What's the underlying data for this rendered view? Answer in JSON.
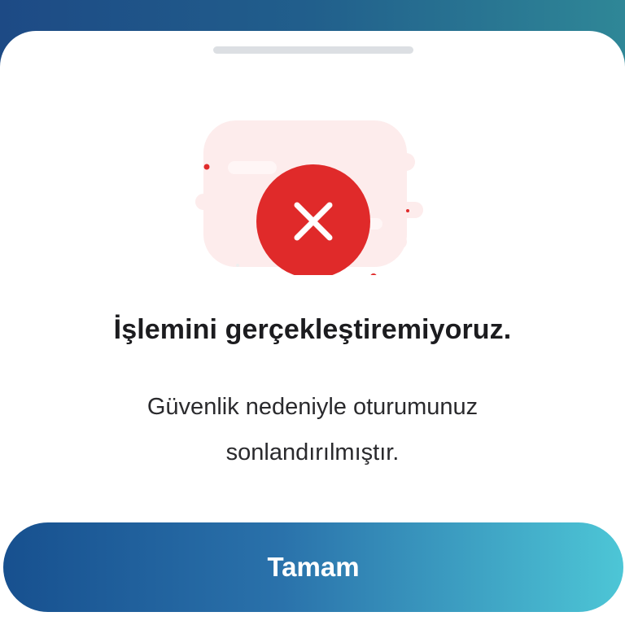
{
  "dialog": {
    "title": "İşlemini gerçekleştiremiyoruz.",
    "message_lines": [
      "Güvenlik nedeniyle oturumunuz",
      "sonlandırılmıştır."
    ],
    "ok_label": "Tamam"
  },
  "icons": {
    "status": "error-x-icon"
  },
  "colors": {
    "header_gradient_start": "#1d4a85",
    "header_gradient_end": "#2f8797",
    "error_red": "#e02a2a",
    "error_halo": "#fdecec",
    "button_gradient_start": "#17508f",
    "button_gradient_end": "#4dc6d6",
    "title_text": "#1c1c1f",
    "grabber": "#dcdfe3"
  }
}
